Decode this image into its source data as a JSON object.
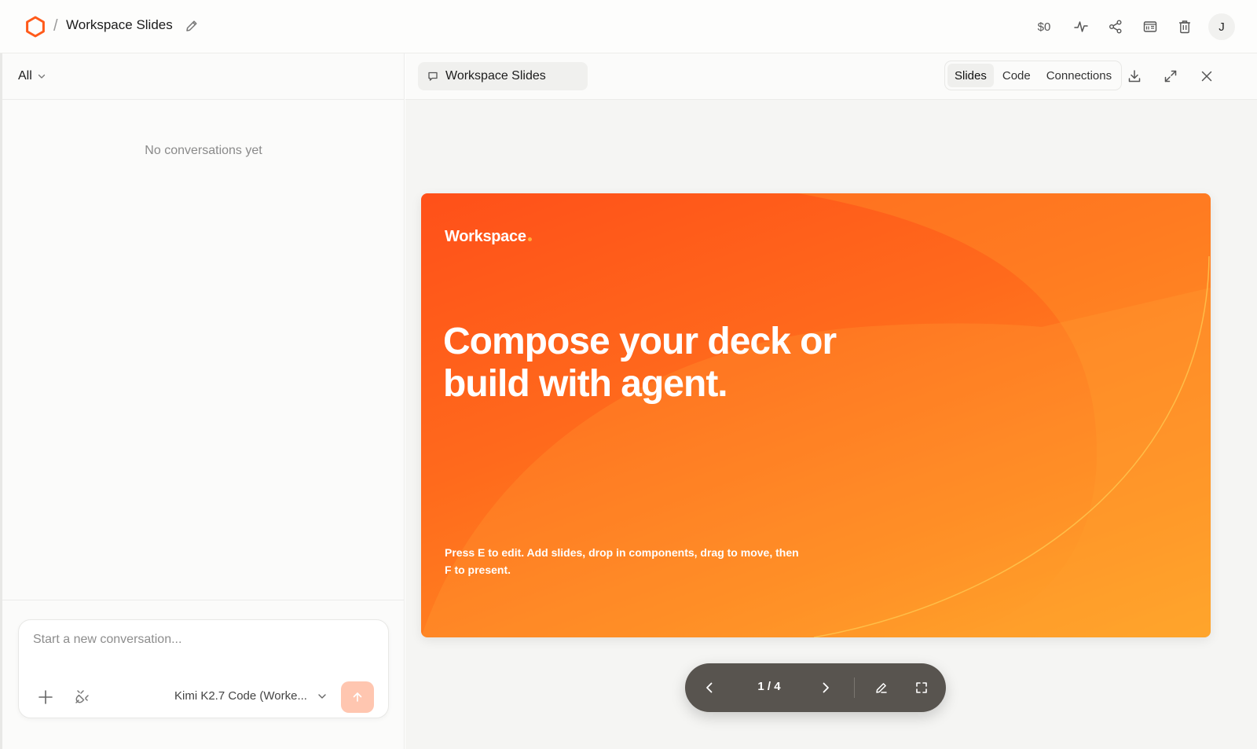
{
  "header": {
    "separator": "/",
    "project_title": "Workspace Slides",
    "cost": "$0",
    "avatar_initial": "J"
  },
  "sidebar": {
    "filter_label": "All",
    "empty_text": "No conversations yet",
    "composer": {
      "placeholder": "Start a new conversation...",
      "model_label": "Kimi K2.7 Code (Worke..."
    }
  },
  "preview": {
    "doc_title": "Workspace Slides",
    "tabs": [
      {
        "label": "Slides",
        "active": true
      },
      {
        "label": "Code",
        "active": false
      },
      {
        "label": "Connections",
        "active": false
      }
    ]
  },
  "slide": {
    "brand": "Workspace",
    "headline_line1": "Compose your deck or",
    "headline_line2": "build with agent.",
    "subtext_line1": "Press E to edit. Add slides, drop in components, drag to move, then",
    "subtext_line2": "F to present."
  },
  "pager": {
    "counter": "1 / 4",
    "current": 1,
    "total": 4
  },
  "colors": {
    "brand_orange": "#ff5a1a",
    "slide_gradient_end": "#ffa826",
    "send_button": "#ffc6b0",
    "pager_bg": "#58544f"
  },
  "icons": [
    "hexagon-logo-icon",
    "pencil-icon",
    "activity-icon",
    "share-icon",
    "panel-icon",
    "trash-icon",
    "chat-icon",
    "download-icon",
    "expand-icon",
    "close-icon",
    "plus-icon",
    "plug-icon",
    "chevron-down-icon",
    "arrow-up-icon",
    "chevron-left-icon",
    "chevron-right-icon",
    "fullscreen-icon"
  ]
}
